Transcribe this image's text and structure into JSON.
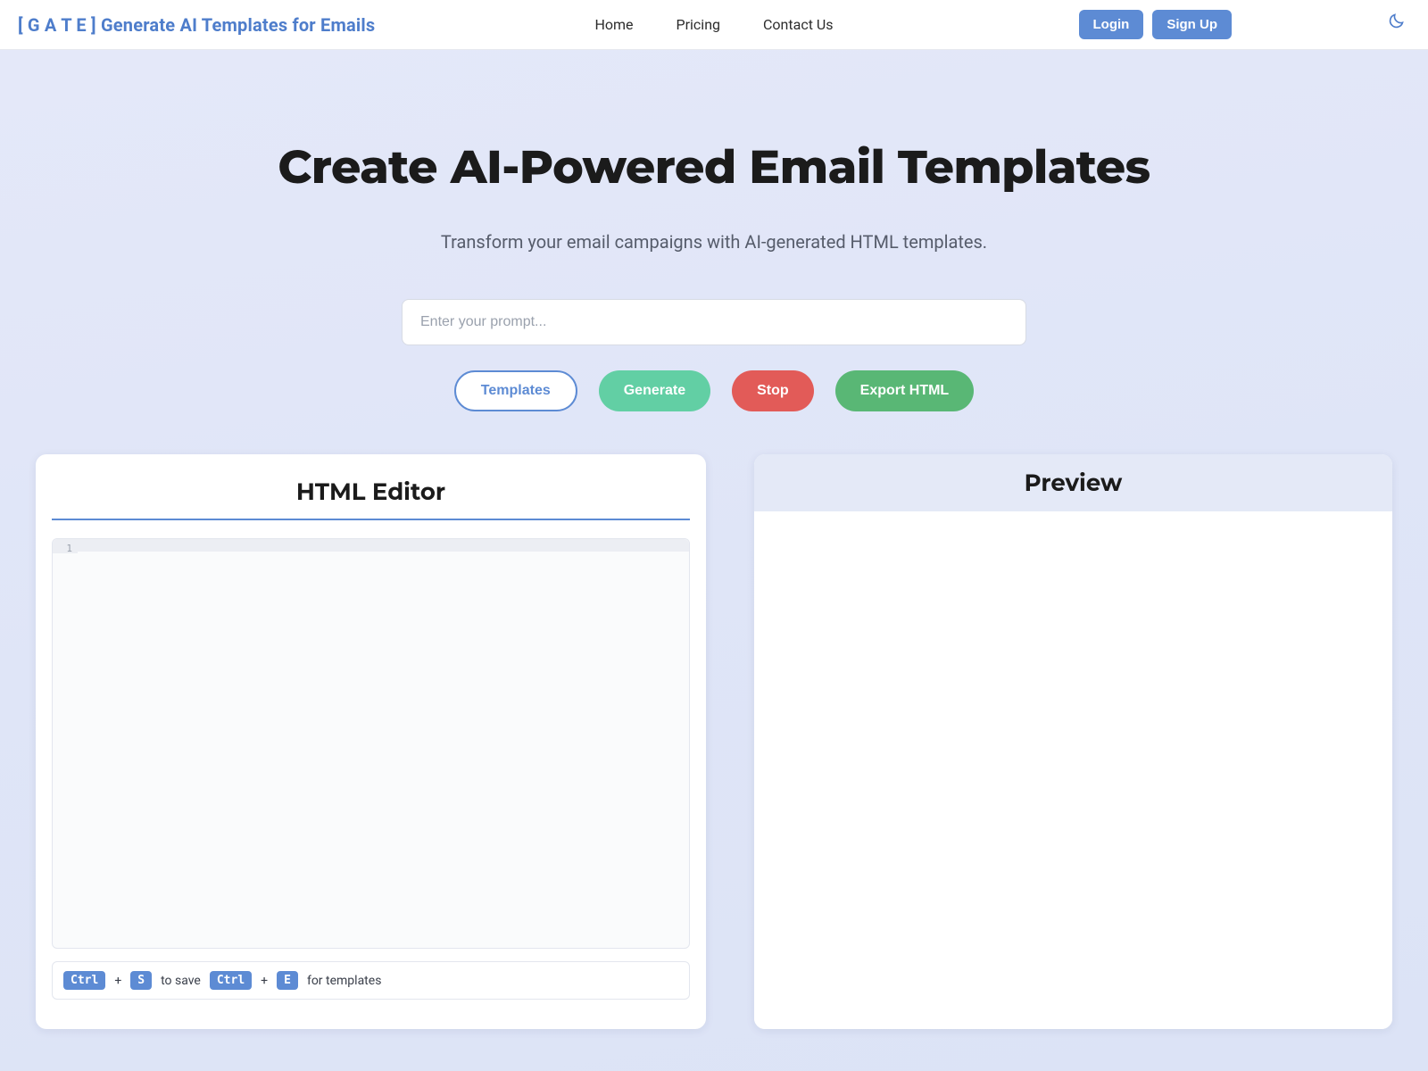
{
  "header": {
    "brand": "[ G A T E ] Generate AI Templates for Emails",
    "nav": {
      "home": "Home",
      "pricing": "Pricing",
      "contact": "Contact Us"
    },
    "login": "Login",
    "signup": "Sign Up"
  },
  "hero": {
    "title": "Create AI-Powered Email Templates",
    "subtitle": "Transform your email campaigns with AI-generated HTML templates.",
    "prompt_placeholder": "Enter your prompt..."
  },
  "actions": {
    "templates": "Templates",
    "generate": "Generate",
    "stop": "Stop",
    "export": "Export HTML"
  },
  "editor": {
    "title": "HTML Editor",
    "first_line_number": "1",
    "shortcuts": {
      "ctrl": "Ctrl",
      "plus": "+",
      "s": "S",
      "save_label": "to save",
      "e": "E",
      "templates_label": "for templates"
    }
  },
  "preview": {
    "title": "Preview"
  },
  "colors": {
    "brand_blue": "#5d8bd4",
    "teal": "#62cfa4",
    "red": "#e25b58",
    "green": "#59b775",
    "bg_gradient_from": "#e4e8f9",
    "bg_gradient_to": "#dce3f6"
  }
}
